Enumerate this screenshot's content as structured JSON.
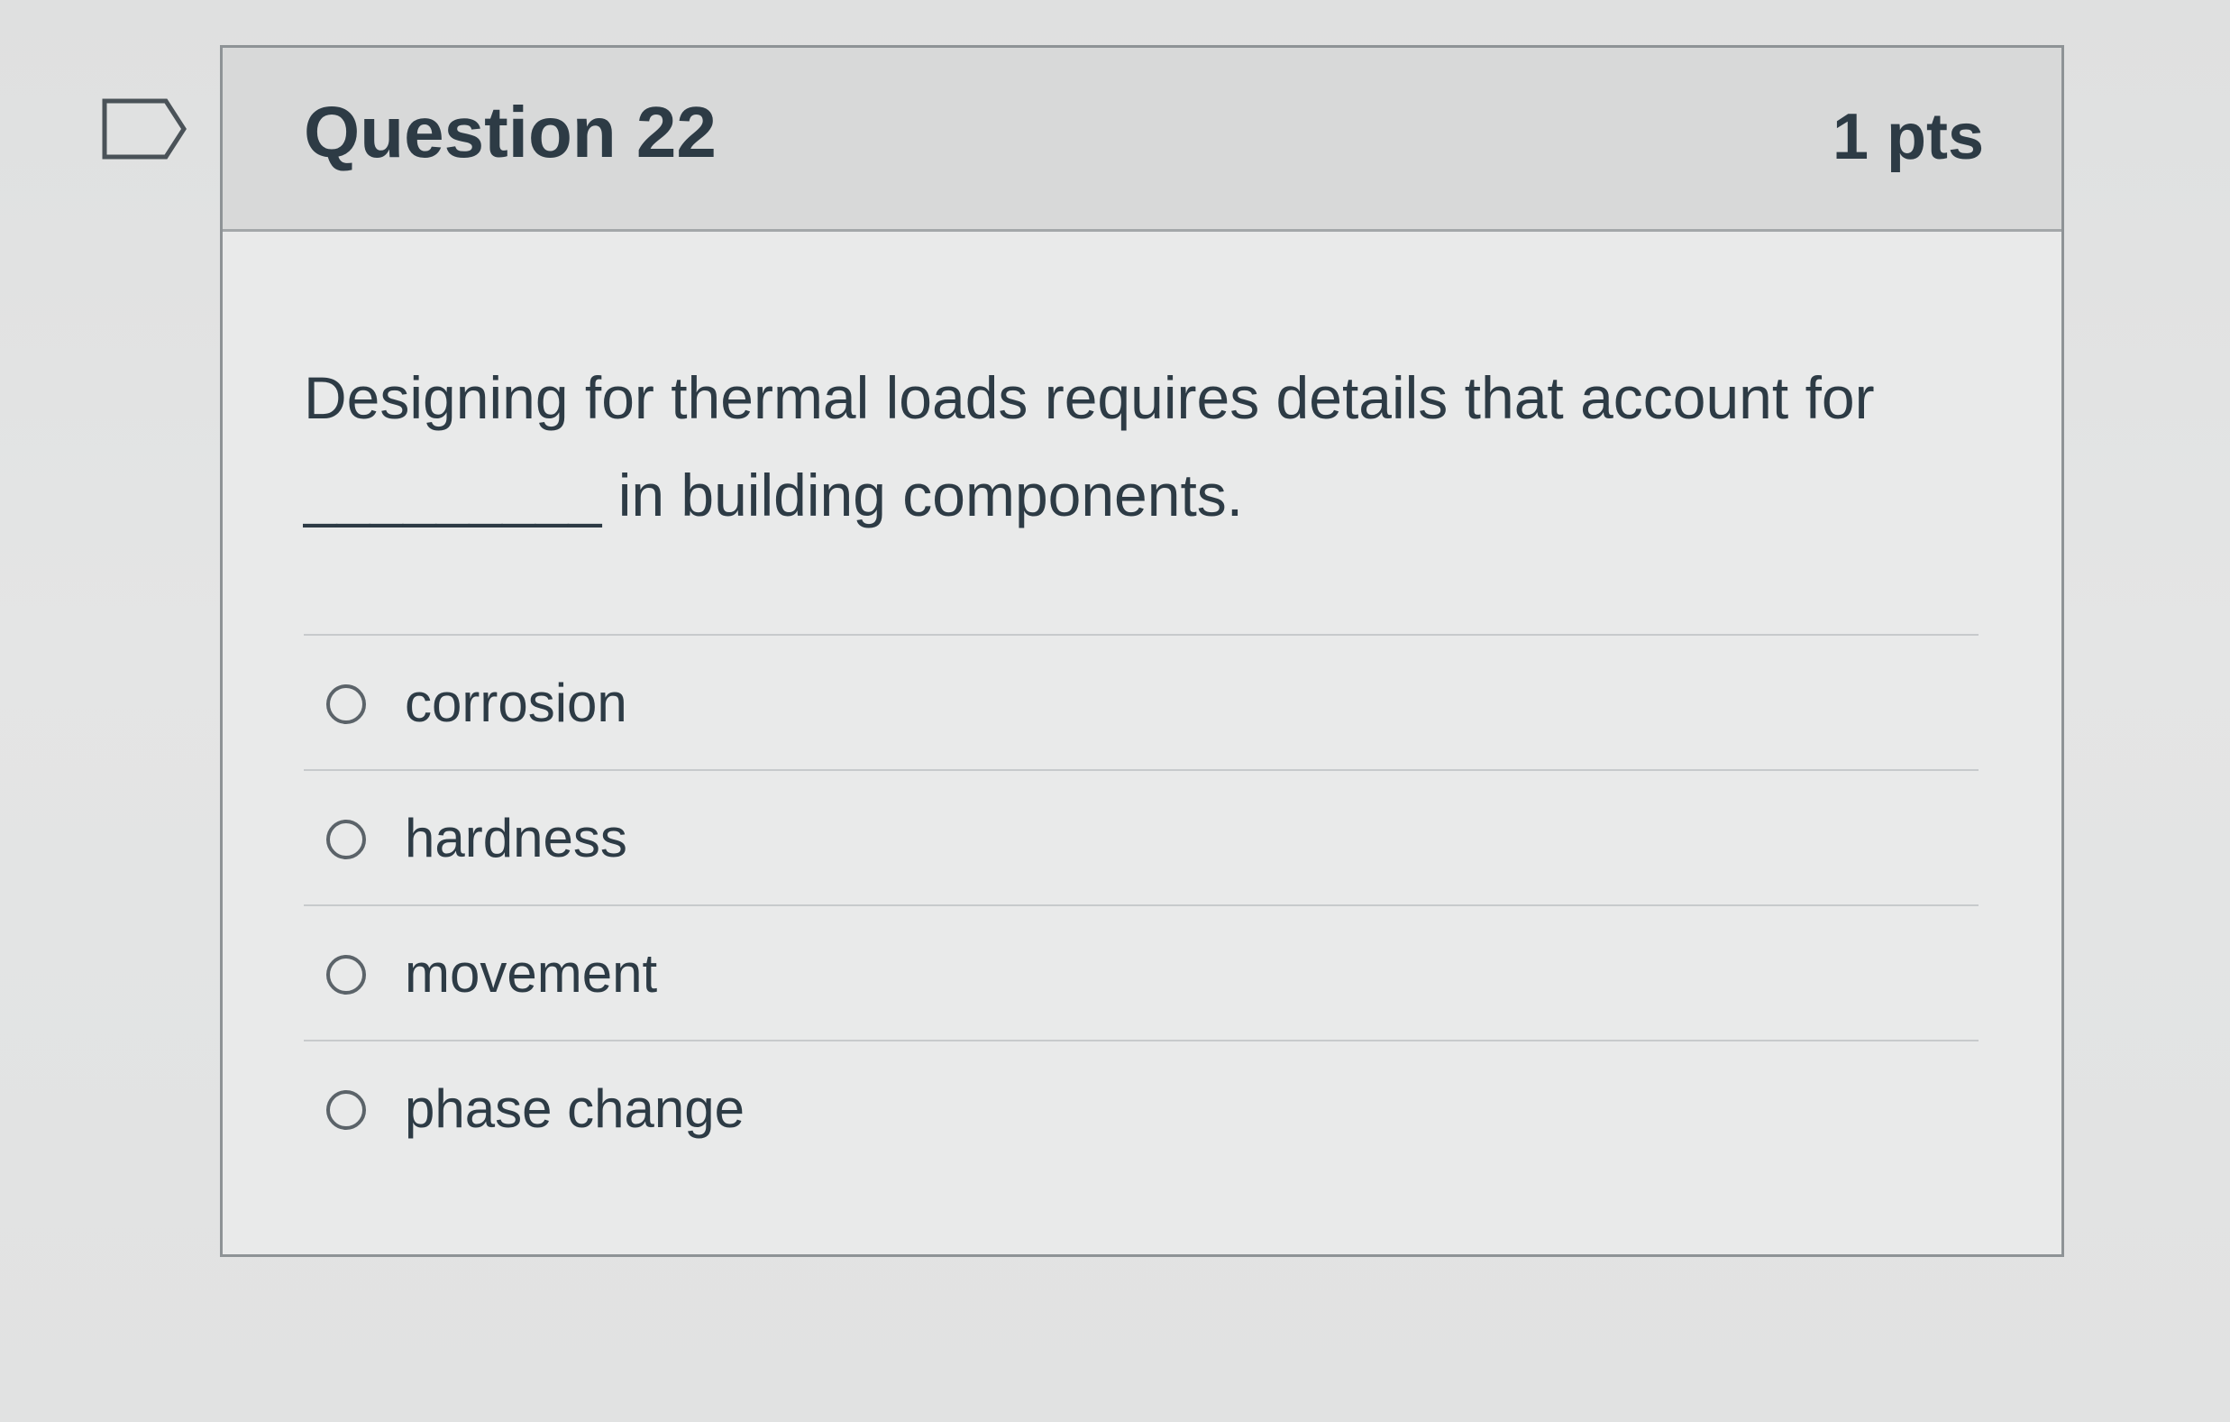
{
  "question": {
    "title": "Question 22",
    "points": "1 pts",
    "text_line1": "Designing for thermal loads requires details that account for",
    "text_line2": "_________ in building components.",
    "flag_icon": "bookmark-flag-icon"
  },
  "answers": [
    {
      "label": "corrosion",
      "selected": false
    },
    {
      "label": "hardness",
      "selected": false
    },
    {
      "label": "movement",
      "selected": false
    },
    {
      "label": "phase change",
      "selected": false
    }
  ],
  "colors": {
    "text": "#2d3b45",
    "header_bg": "#d8d9d9",
    "card_bg": "#e9eaea",
    "border": "#8e9396"
  }
}
